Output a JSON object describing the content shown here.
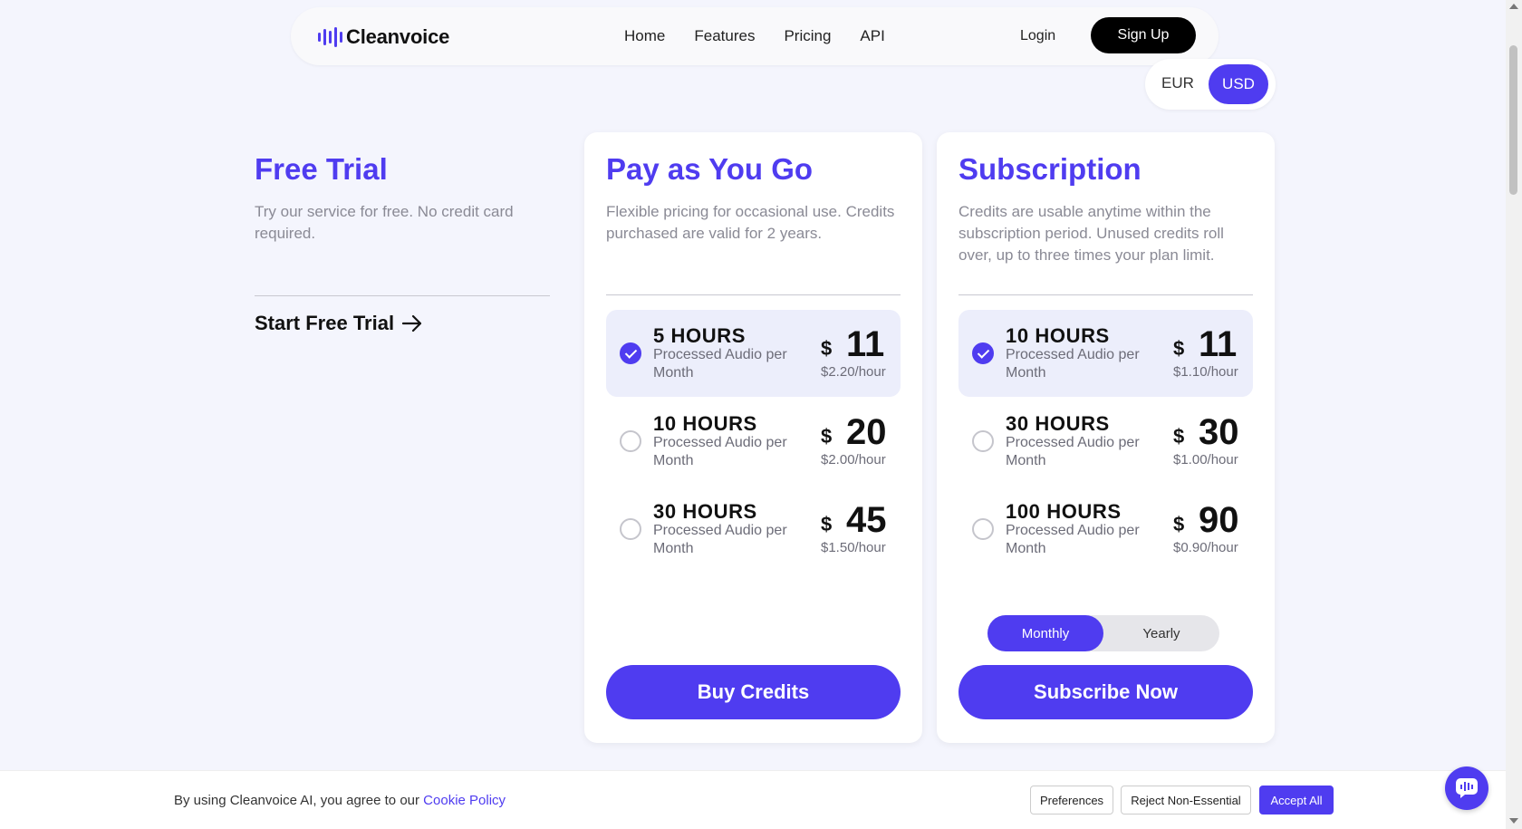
{
  "nav": {
    "logo": "Cleanvoice",
    "links": [
      "Home",
      "Features",
      "Pricing",
      "API"
    ],
    "login": "Login",
    "signup": "Sign Up"
  },
  "currency": {
    "eur": "EUR",
    "usd": "USD",
    "selected": "USD"
  },
  "free_trial": {
    "title": "Free Trial",
    "desc": "Try our service for free. No credit card required.",
    "cta": "Start Free Trial"
  },
  "payg": {
    "title": "Pay as You Go",
    "desc": "Flexible pricing for occasional use. Credits purchased are valid for 2 years.",
    "plans": [
      {
        "hours": "5 HOURS",
        "sub": "Processed Audio per Month",
        "cur": "$",
        "price": "11",
        "rate": "$2.20/hour",
        "selected": true
      },
      {
        "hours": "10 HOURS",
        "sub": "Processed Audio per Month",
        "cur": "$",
        "price": "20",
        "rate": "$2.00/hour",
        "selected": false
      },
      {
        "hours": "30 HOURS",
        "sub": "Processed Audio per Month",
        "cur": "$",
        "price": "45",
        "rate": "$1.50/hour",
        "selected": false
      }
    ],
    "cta": "Buy Credits"
  },
  "subscription": {
    "title": "Subscription",
    "desc": "Credits are usable anytime within the subscription period. Unused credits roll over, up to three times your plan limit.",
    "plans": [
      {
        "hours": "10 HOURS",
        "sub": "Processed Audio per Month",
        "cur": "$",
        "price": "11",
        "rate": "$1.10/hour",
        "selected": true
      },
      {
        "hours": "30 HOURS",
        "sub": "Processed Audio per Month",
        "cur": "$",
        "price": "30",
        "rate": "$1.00/hour",
        "selected": false
      },
      {
        "hours": "100 HOURS",
        "sub": "Processed Audio per Month",
        "cur": "$",
        "price": "90",
        "rate": "$0.90/hour",
        "selected": false
      }
    ],
    "period": {
      "monthly": "Monthly",
      "yearly": "Yearly",
      "selected": "Monthly"
    },
    "cta": "Subscribe Now"
  },
  "cookie": {
    "text": "By using Cleanvoice AI, you agree to our ",
    "link": "Cookie Policy",
    "preferences": "Preferences",
    "reject": "Reject Non-Essential",
    "accept": "Accept All"
  },
  "colors": {
    "accent": "#4f3cf0",
    "background": "#f4f5fd"
  },
  "icons": {
    "chat": "chat-bubble-icon",
    "arrow": "arrow-right-icon",
    "check": "check-icon"
  }
}
